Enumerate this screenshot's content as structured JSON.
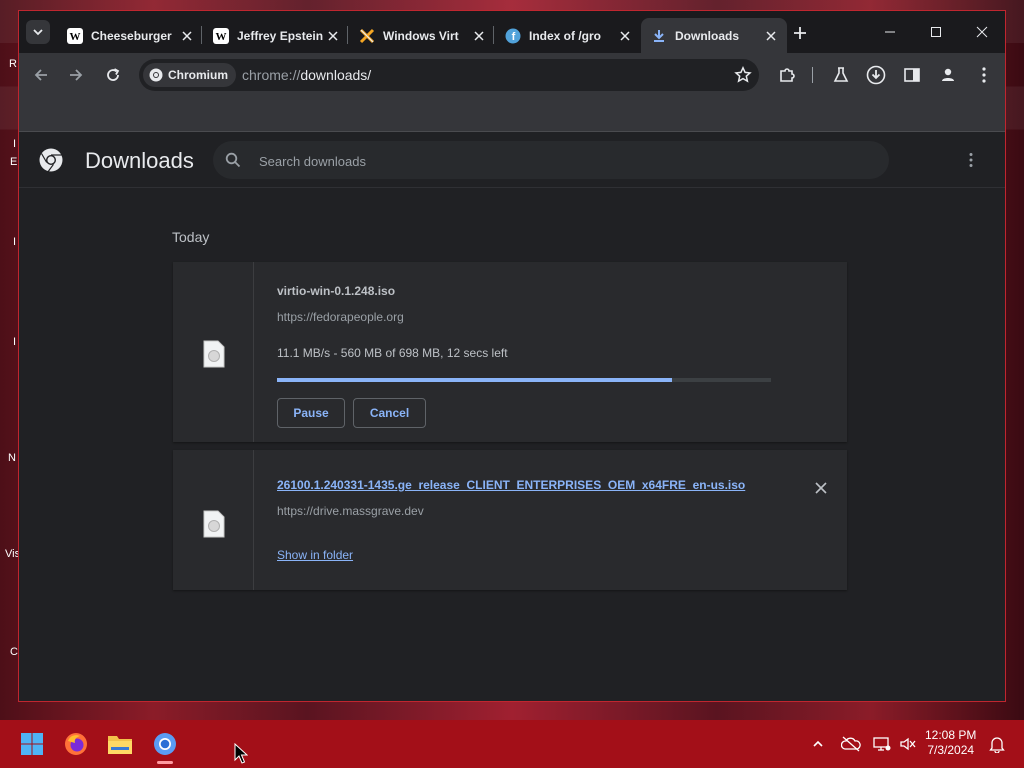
{
  "desktop": {
    "edge_letters": [
      "R",
      "I",
      "E",
      "I",
      "I",
      "N",
      "Vis",
      "C"
    ]
  },
  "browser": {
    "tabs": [
      {
        "title": "Cheeseburger",
        "icon": "wikipedia-icon",
        "active": false
      },
      {
        "title": "Jeffrey Epstein",
        "icon": "wikipedia-icon",
        "active": false
      },
      {
        "title": "Windows Virt",
        "icon": "x-logo-icon",
        "active": false
      },
      {
        "title": "Index of /gro",
        "icon": "fedora-icon",
        "active": false
      },
      {
        "title": "Downloads",
        "icon": "download-icon",
        "active": true
      }
    ],
    "omnibox": {
      "chip_label": "Chromium",
      "url_scheme": "chrome://",
      "url_path": "downloads/"
    }
  },
  "downloads_page": {
    "title": "Downloads",
    "search_placeholder": "Search downloads",
    "section_label": "Today",
    "items": [
      {
        "filename": "virtio-win-0.1.248.iso",
        "source": "https://fedorapeople.org",
        "status": "11.1 MB/s - 560 MB of 698 MB, 12 secs left",
        "progress": 0.8,
        "pause_label": "Pause",
        "cancel_label": "Cancel"
      },
      {
        "filename": "26100.1.240331-1435.ge_release_CLIENT_ENTERPRISES_OEM_x64FRE_en-us.iso",
        "source": "https://drive.massgrave.dev",
        "show_in_folder_label": "Show in folder"
      }
    ]
  },
  "taskbar": {
    "time": "12:08 PM",
    "date": "7/3/2024",
    "apps": [
      "windows-start-icon",
      "firefox-icon",
      "file-explorer-icon",
      "chromium-icon"
    ]
  },
  "colors": {
    "accent": "#8ab4f8",
    "taskbar": "#a30f18",
    "page_bg": "#202124"
  }
}
